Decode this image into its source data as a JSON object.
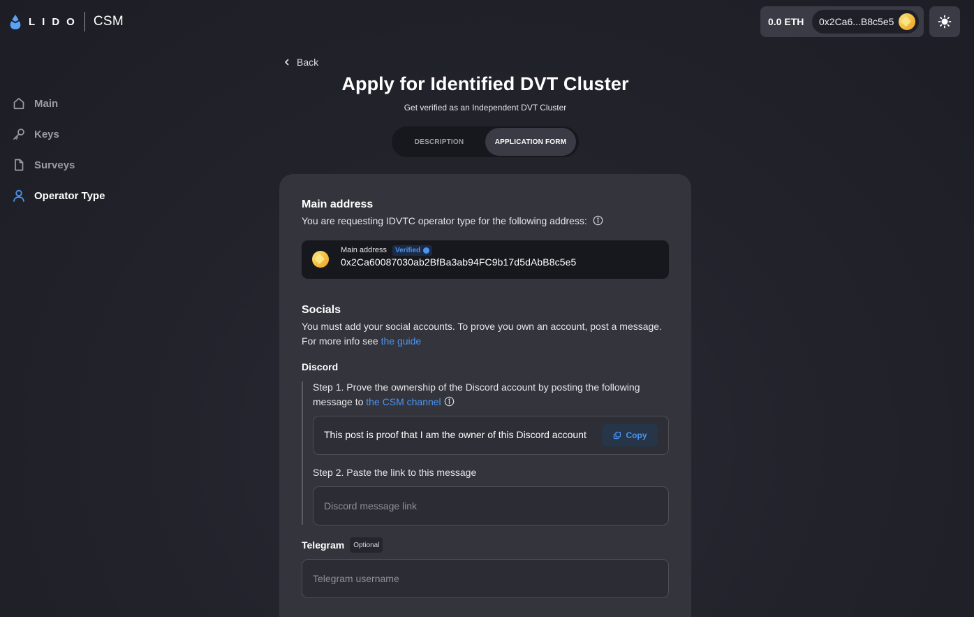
{
  "header": {
    "logo_word": "LIDO",
    "logo_product": "CSM",
    "wallet_balance": "0.0 ETH",
    "wallet_address_short": "0x2Ca6...B8c5e5"
  },
  "sidebar": {
    "items": [
      {
        "label": "Main",
        "icon": "home-icon"
      },
      {
        "label": "Keys",
        "icon": "key-icon"
      },
      {
        "label": "Surveys",
        "icon": "file-icon"
      },
      {
        "label": "Operator Type",
        "icon": "user-icon",
        "active": true
      }
    ]
  },
  "page": {
    "back_label": "Back",
    "title": "Apply for Identified DVT Cluster",
    "subtitle": "Get verified as an Independent DVT Cluster",
    "tabs": [
      {
        "label": "DESCRIPTION",
        "active": false
      },
      {
        "label": "APPLICATION FORM",
        "active": true
      }
    ]
  },
  "form": {
    "main_address": {
      "title": "Main address",
      "description": "You are requesting IDVTC operator type for the following address:",
      "label": "Main address",
      "verified_label": "Verified",
      "value": "0x2Ca60087030ab2BfBa3ab94FC9b17d5dAbB8c5e5"
    },
    "socials": {
      "title": "Socials",
      "description": "You must add your social accounts. To prove you own an account, post a message.",
      "info_prefix": "For more info see ",
      "guide_link": "the guide"
    },
    "discord": {
      "title": "Discord",
      "step1_text": "Step 1. Prove the ownership of the Discord account by posting the following message to ",
      "step1_link": "the CSM channel",
      "message": "This post is proof that I am the owner of this Discord account",
      "copy_label": "Copy",
      "step2_text": "Step 2. Paste the link to this message",
      "link_placeholder": "Discord message link"
    },
    "telegram": {
      "title": "Telegram",
      "optional_label": "Optional",
      "placeholder": "Telegram username"
    }
  },
  "colors": {
    "background": "#22232b",
    "card": "#33343c",
    "accent": "#4a95f3",
    "coin": "#f5c544"
  }
}
